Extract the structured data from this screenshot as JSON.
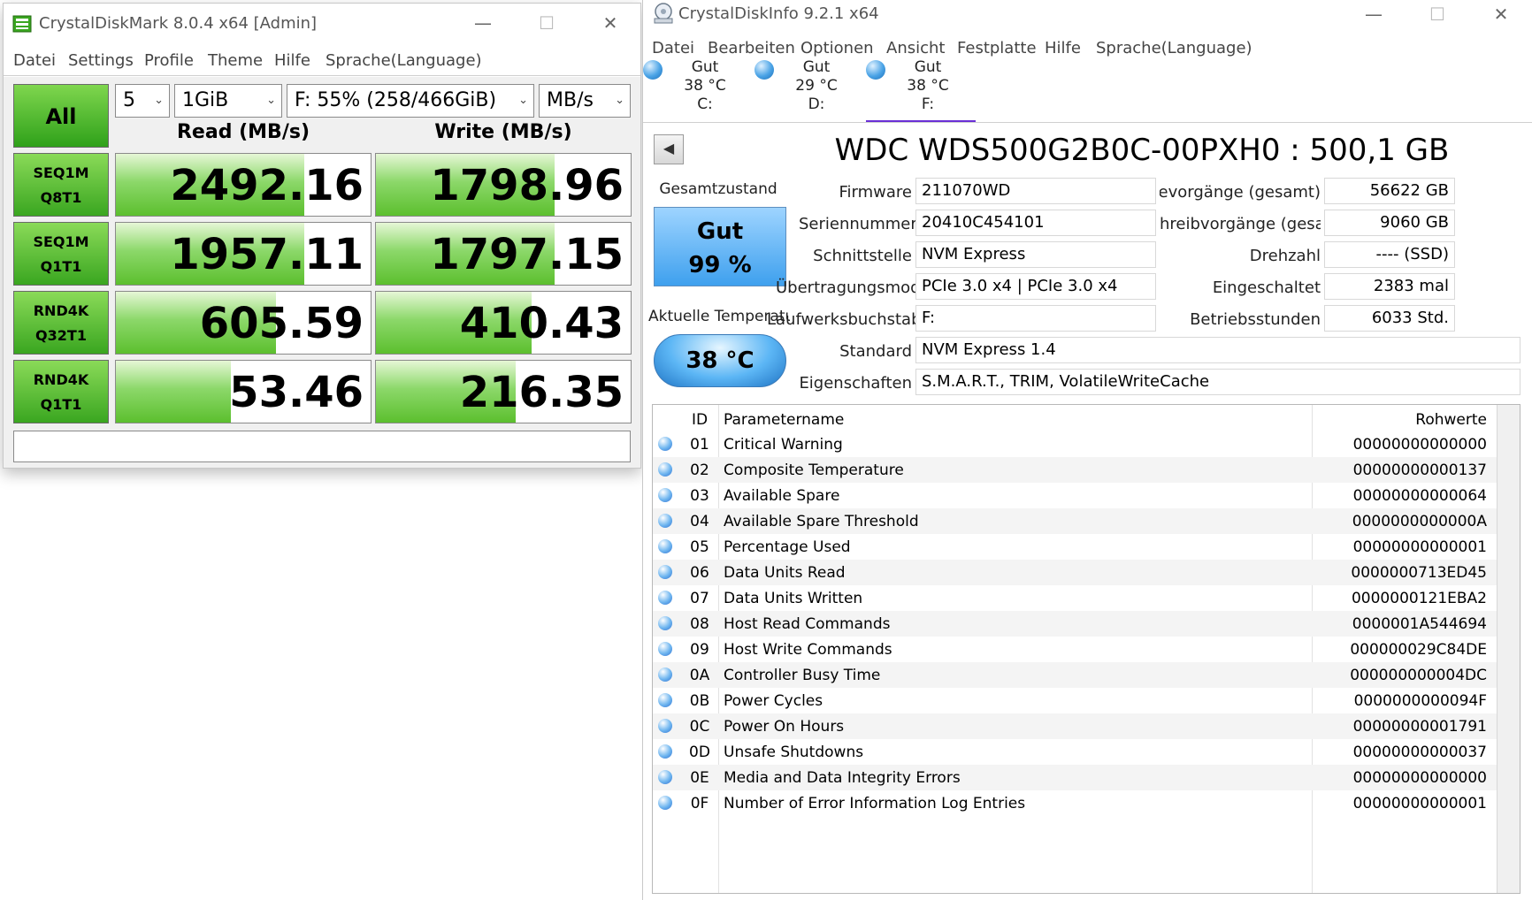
{
  "cdm": {
    "title": "CrystalDiskMark 8.0.4 x64 [Admin]",
    "window_controls": {
      "minimize": "—",
      "maximize": "☐",
      "close": "✕"
    },
    "menu": [
      "Datei",
      "Settings",
      "Profile",
      "Theme",
      "Hilfe",
      "Sprache(Language)"
    ],
    "all_label": "All",
    "count": "5",
    "size": "1GiB",
    "drive": "F: 55% (258/466GiB)",
    "unit": "MB/s",
    "read_header": "Read (MB/s)",
    "write_header": "Write (MB/s)",
    "tests": [
      {
        "l1": "SEQ1M",
        "l2": "Q8T1",
        "read": "2492.16",
        "write": "1798.96",
        "read_frac": 0.74,
        "write_frac": 0.7
      },
      {
        "l1": "SEQ1M",
        "l2": "Q1T1",
        "read": "1957.11",
        "write": "1797.15",
        "read_frac": 0.74,
        "write_frac": 0.7
      },
      {
        "l1": "RND4K",
        "l2": "Q32T1",
        "read": "605.59",
        "write": "410.43",
        "read_frac": 0.63,
        "write_frac": 0.61
      },
      {
        "l1": "RND4K",
        "l2": "Q1T1",
        "read": "53.46",
        "write": "216.35",
        "read_frac": 0.45,
        "write_frac": 0.55
      }
    ],
    "comment": ""
  },
  "cdi": {
    "title": "CrystalDiskInfo 9.2.1 x64",
    "window_controls": {
      "minimize": "—",
      "maximize": "☐",
      "close": "✕"
    },
    "menu": [
      "Datei",
      "Bearbeiten",
      "Optionen",
      "Ansicht",
      "Festplatte",
      "Hilfe",
      "Sprache(Language)"
    ],
    "drives": [
      {
        "status": "Gut",
        "temp": "38 °C",
        "letter": "C:"
      },
      {
        "status": "Gut",
        "temp": "29 °C",
        "letter": "D:"
      },
      {
        "status": "Gut",
        "temp": "38 °C",
        "letter": "F:"
      }
    ],
    "drive_name": "WDC WDS500G2B0C-00PXH0 : 500,1 GB",
    "back_glyph": "◀",
    "health_label": "Gesamtzustand",
    "health_status": "Gut",
    "health_percent": "99 %",
    "temp_label": "Aktuelle Temperatu",
    "temp_value": "38 °C",
    "info": {
      "firmware_label": "Firmware",
      "firmware": "211070WD",
      "serial_label": "Seriennummer",
      "serial": "20410C454101",
      "interface_label": "Schnittstelle",
      "interface": "NVM Express",
      "transfer_label": "Übertragungsmodus",
      "transfer": "PCIe 3.0 x4 | PCIe 3.0 x4",
      "letters_label": "Laufwerksbuchstaben",
      "letters": "F:",
      "standard_label": "Standard",
      "standard": "NVM Express 1.4",
      "features_label": "Eigenschaften",
      "features": "S.M.A.R.T., TRIM, VolatileWriteCache",
      "reads_label": "Lesevorgänge (gesamt)",
      "reads": "56622 GB",
      "writes_label": "hreibvorgänge (gesamt)",
      "writes": "9060 GB",
      "rpm_label": "Drehzahl",
      "rpm": "---- (SSD)",
      "power_count_label": "Eingeschaltet",
      "power_count": "2383 mal",
      "hours_label": "Betriebsstunden",
      "hours": "6033 Std."
    },
    "smart": {
      "headers": {
        "id": "ID",
        "name": "Parametername",
        "raw": "Rohwerte"
      },
      "rows": [
        {
          "id": "01",
          "name": "Critical Warning",
          "raw": "00000000000000"
        },
        {
          "id": "02",
          "name": "Composite Temperature",
          "raw": "00000000000137"
        },
        {
          "id": "03",
          "name": "Available Spare",
          "raw": "00000000000064"
        },
        {
          "id": "04",
          "name": "Available Spare Threshold",
          "raw": "0000000000000A"
        },
        {
          "id": "05",
          "name": "Percentage Used",
          "raw": "00000000000001"
        },
        {
          "id": "06",
          "name": "Data Units Read",
          "raw": "0000000713ED45"
        },
        {
          "id": "07",
          "name": "Data Units Written",
          "raw": "0000000121EBA2"
        },
        {
          "id": "08",
          "name": "Host Read Commands",
          "raw": "0000001A544694"
        },
        {
          "id": "09",
          "name": "Host Write Commands",
          "raw": "000000029C84DE"
        },
        {
          "id": "0A",
          "name": "Controller Busy Time",
          "raw": "000000000004DC"
        },
        {
          "id": "0B",
          "name": "Power Cycles",
          "raw": "0000000000094F"
        },
        {
          "id": "0C",
          "name": "Power On Hours",
          "raw": "00000000001791"
        },
        {
          "id": "0D",
          "name": "Unsafe Shutdowns",
          "raw": "00000000000037"
        },
        {
          "id": "0E",
          "name": "Media and Data Integrity Errors",
          "raw": "00000000000000"
        },
        {
          "id": "0F",
          "name": "Number of Error Information Log Entries",
          "raw": "00000000000001"
        }
      ]
    }
  },
  "colors": {
    "green_accent": "#5cbf2e",
    "blue_accent": "#3ea0ee",
    "selected_tab": "#6a2fd6"
  }
}
